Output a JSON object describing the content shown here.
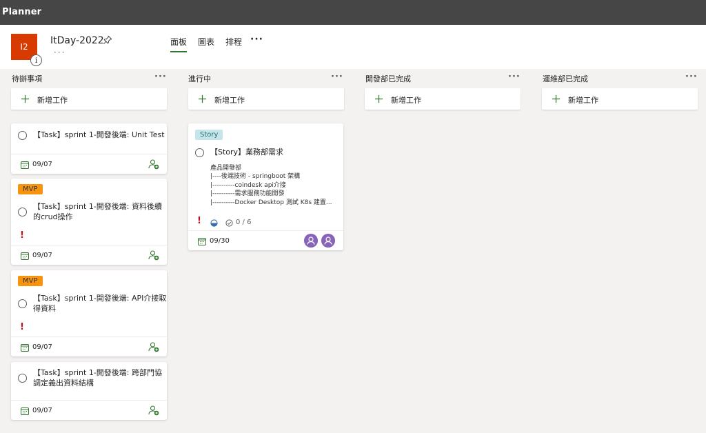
{
  "app": {
    "title": "Planner"
  },
  "plan": {
    "initials": "I2",
    "name": "ItDay-2022",
    "more": "···",
    "info": "i"
  },
  "tabs": [
    {
      "label": "面板",
      "active": true
    },
    {
      "label": "圖表",
      "active": false
    },
    {
      "label": "排程",
      "active": false
    }
  ],
  "tab_more": "···",
  "add_task_label": "新增工作",
  "buckets": [
    {
      "title": "待辦事項",
      "actions": "···"
    },
    {
      "title": "進行中",
      "actions": "···"
    },
    {
      "title": "開發部已完成",
      "actions": "···"
    },
    {
      "title": "運維部已完成",
      "actions": "···"
    }
  ],
  "todo_cards": [
    {
      "title_lines": [
        "【Task】sprint 1-開發後端: Unit Test"
      ],
      "due": "09/07"
    },
    {
      "label": "MVP",
      "title_lines": [
        "【Task】sprint 1-開發後端: 資料後續",
        "的crud操作"
      ],
      "priority": "!",
      "due": "09/07"
    },
    {
      "label": "MVP",
      "title_lines": [
        "【Task】sprint 1-開發後端: API介接取",
        "得資料"
      ],
      "priority": "!",
      "due": "09/07"
    },
    {
      "title_lines": [
        "【Task】sprint 1-開發後端: 跨部門協",
        "調定義出資料結構"
      ],
      "due": "09/07"
    }
  ],
  "story_card": {
    "label": "Story",
    "title": "【Story】業務部需求",
    "description": [
      "產品開發部",
      "|----後端技術 - springboot 架構",
      "|----------coindesk api介接",
      "|----------需求服務功能開發",
      "|----------Docker Desktop 測試 K8s 建置..."
    ],
    "priority": "!",
    "checklist": "0 / 6",
    "due": "09/30"
  },
  "colors": {
    "topbar": "#464646",
    "accent_green": "#31752f",
    "plan_avatar": "#d83b01",
    "mvp_label": "#f7940f",
    "story_label": "#c5e5e8",
    "priority": "#c50f1f",
    "user_avatar": "#8764b8"
  },
  "icons": [
    "pin-icon",
    "info-icon",
    "plus-icon",
    "calendar-icon",
    "assign-user-icon",
    "progress-icon",
    "checklist-icon",
    "user-avatar-icon"
  ]
}
